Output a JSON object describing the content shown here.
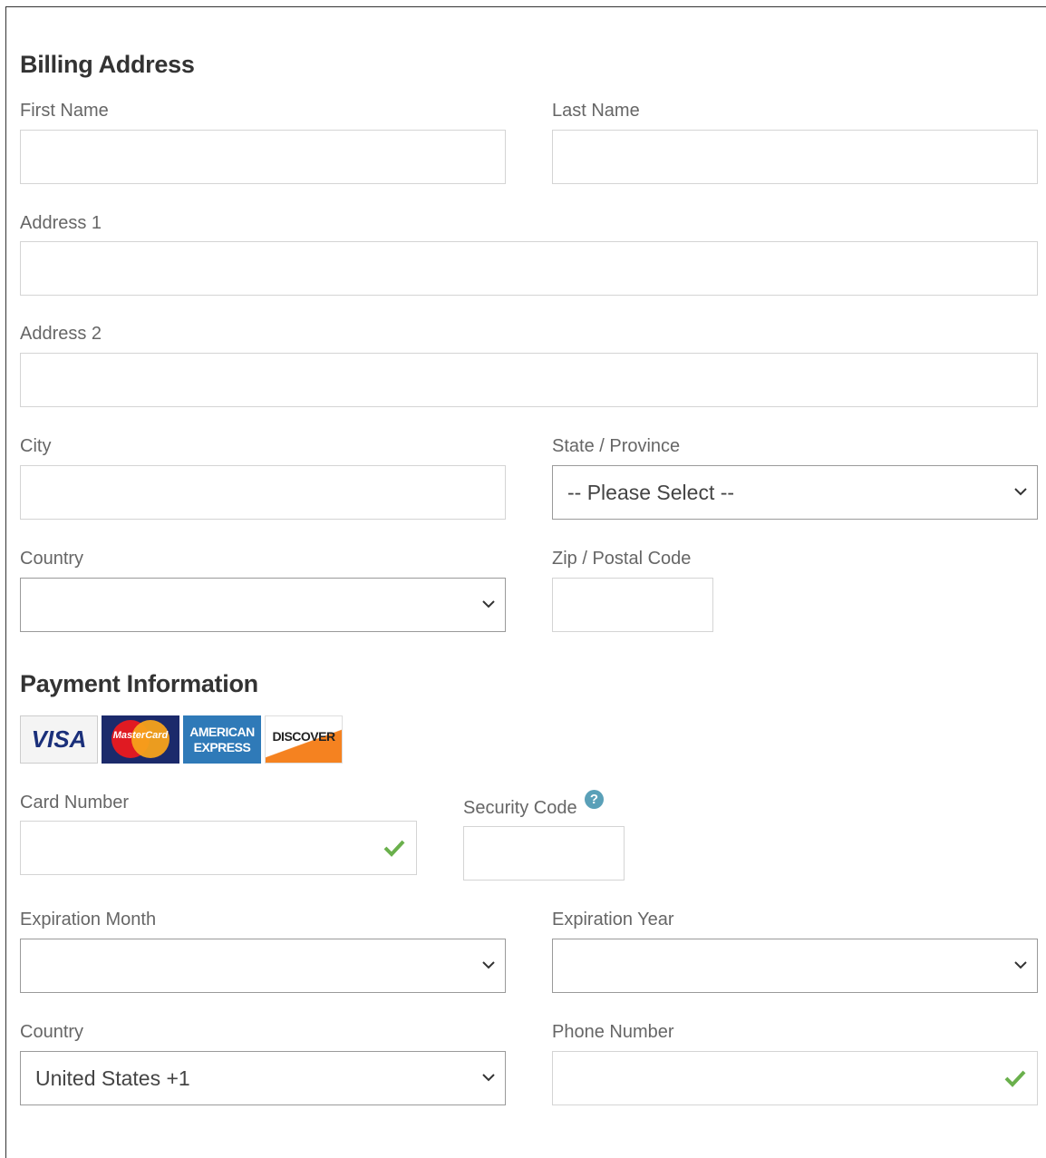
{
  "billing": {
    "title": "Billing Address",
    "first_name_label": "First Name",
    "last_name_label": "Last Name",
    "address1_label": "Address 1",
    "address2_label": "Address 2",
    "city_label": "City",
    "state_label": "State / Province",
    "state_value": "-- Please Select --",
    "country_label": "Country",
    "country_value": "",
    "zip_label": "Zip / Postal Code"
  },
  "payment": {
    "title": "Payment Information",
    "cards": [
      {
        "name": "visa",
        "text": "VISA"
      },
      {
        "name": "mastercard",
        "text": "MasterCard"
      },
      {
        "name": "american-express",
        "line1": "AMERICAN",
        "line2": "EXPRESS"
      },
      {
        "name": "discover",
        "text": "DISCOVER"
      }
    ],
    "card_number_label": "Card Number",
    "security_code_label": "Security Code",
    "help_glyph": "?",
    "exp_month_label": "Expiration Month",
    "exp_year_label": "Expiration Year",
    "phone_country_label": "Country",
    "phone_country_value": "United States +1",
    "phone_label": "Phone Number"
  },
  "colors": {
    "valid_check": "#6ab04c",
    "help_badge": "#5aa0b8"
  }
}
